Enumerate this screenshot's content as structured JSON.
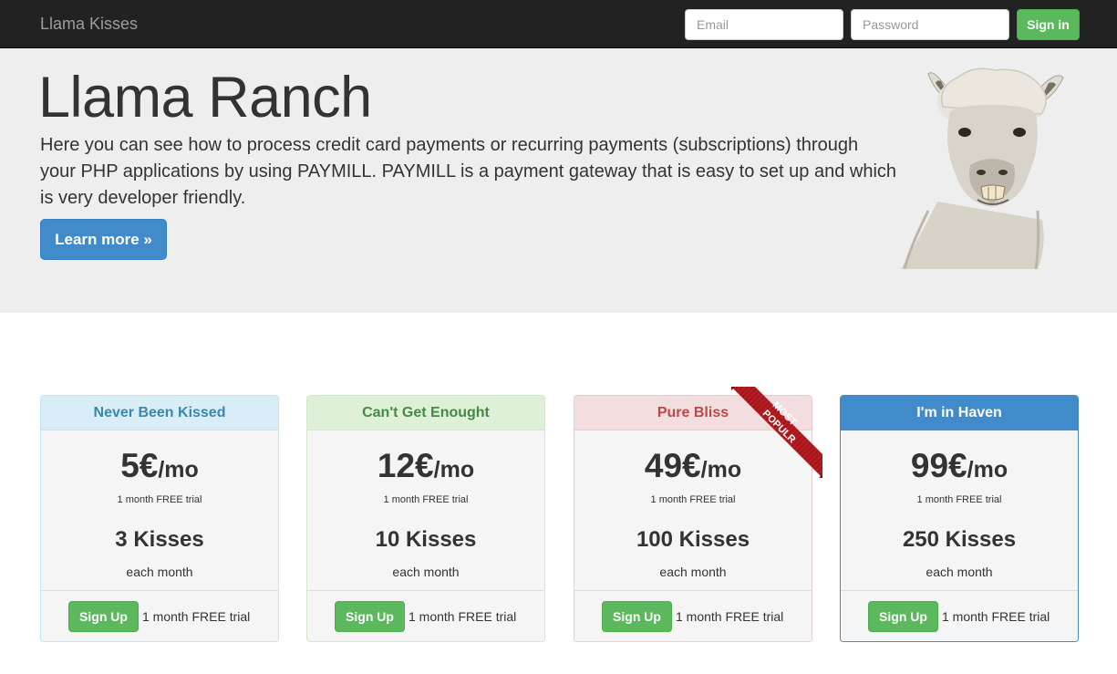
{
  "navbar": {
    "brand": "Llama Kisses",
    "email_placeholder": "Email",
    "password_placeholder": "Password",
    "signin_label": "Sign in"
  },
  "jumbotron": {
    "title": "Llama Ranch",
    "text": "Here you can see how to process credit card payments or recurring payments (subscriptions) through your PHP applications by using PAYMILL. PAYMILL is a payment gateway that is easy to set up and which is very developer friendly.",
    "button_label": "Learn more »"
  },
  "ribbon": {
    "line1": "MOST",
    "line2": "POPULR",
    "color": "#b81d24"
  },
  "plans": [
    {
      "name": "Never Been Kissed",
      "price": "5€",
      "per": "/mo",
      "trial": "1 month FREE trial",
      "kisses": "3 Kisses",
      "each": "each month",
      "signup_label": "Sign Up",
      "foot_trial": "1 month FREE trial"
    },
    {
      "name": "Can't Get Enought",
      "price": "12€",
      "per": "/mo",
      "trial": "1 month FREE trial",
      "kisses": "10 Kisses",
      "each": "each month",
      "signup_label": "Sign Up",
      "foot_trial": "1 month FREE trial"
    },
    {
      "name": "Pure Bliss",
      "price": "49€",
      "per": "/mo",
      "trial": "1 month FREE trial",
      "kisses": "100 Kisses",
      "each": "each month",
      "signup_label": "Sign Up",
      "foot_trial": "1 month FREE trial"
    },
    {
      "name": "I'm in Haven",
      "price": "99€",
      "per": "/mo",
      "trial": "1 month FREE trial",
      "kisses": "250 Kisses",
      "each": "each month",
      "signup_label": "Sign Up",
      "foot_trial": "1 month FREE trial"
    }
  ],
  "colors": {
    "navbar": "#222222",
    "jumbotron": "#eeeeee",
    "primary": "#428bca",
    "success": "#5cb85c"
  }
}
